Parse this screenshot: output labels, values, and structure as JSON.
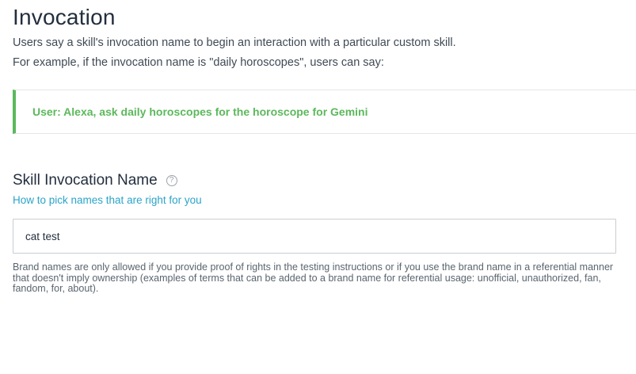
{
  "header": {
    "title": "Invocation",
    "intro_line_1": "Users say a skill's invocation name to begin an interaction with a particular custom skill.",
    "intro_line_2": "For example, if the invocation name is \"daily horoscopes\", users can say:"
  },
  "example": {
    "utterance": "User: Alexa, ask daily horoscopes for the horoscope for Gemini",
    "accent_color": "#5cb85c"
  },
  "skill_invocation": {
    "heading": "Skill Invocation Name",
    "help_icon": "question-mark-icon",
    "help_icon_glyph": "?",
    "link_text": "How to pick names that are right for you",
    "input_value": "cat test",
    "note": "Brand names are only allowed if you provide proof of rights in the testing instructions or if you use the brand name in a referential manner that doesn't imply ownership (examples of terms that can be added to a brand name for referential usage: unofficial, unauthorized, fan, fandom, for, about)."
  },
  "colors": {
    "link": "#2aa4c9",
    "success_green": "#5cb85c",
    "text_dark": "#232f3e"
  }
}
